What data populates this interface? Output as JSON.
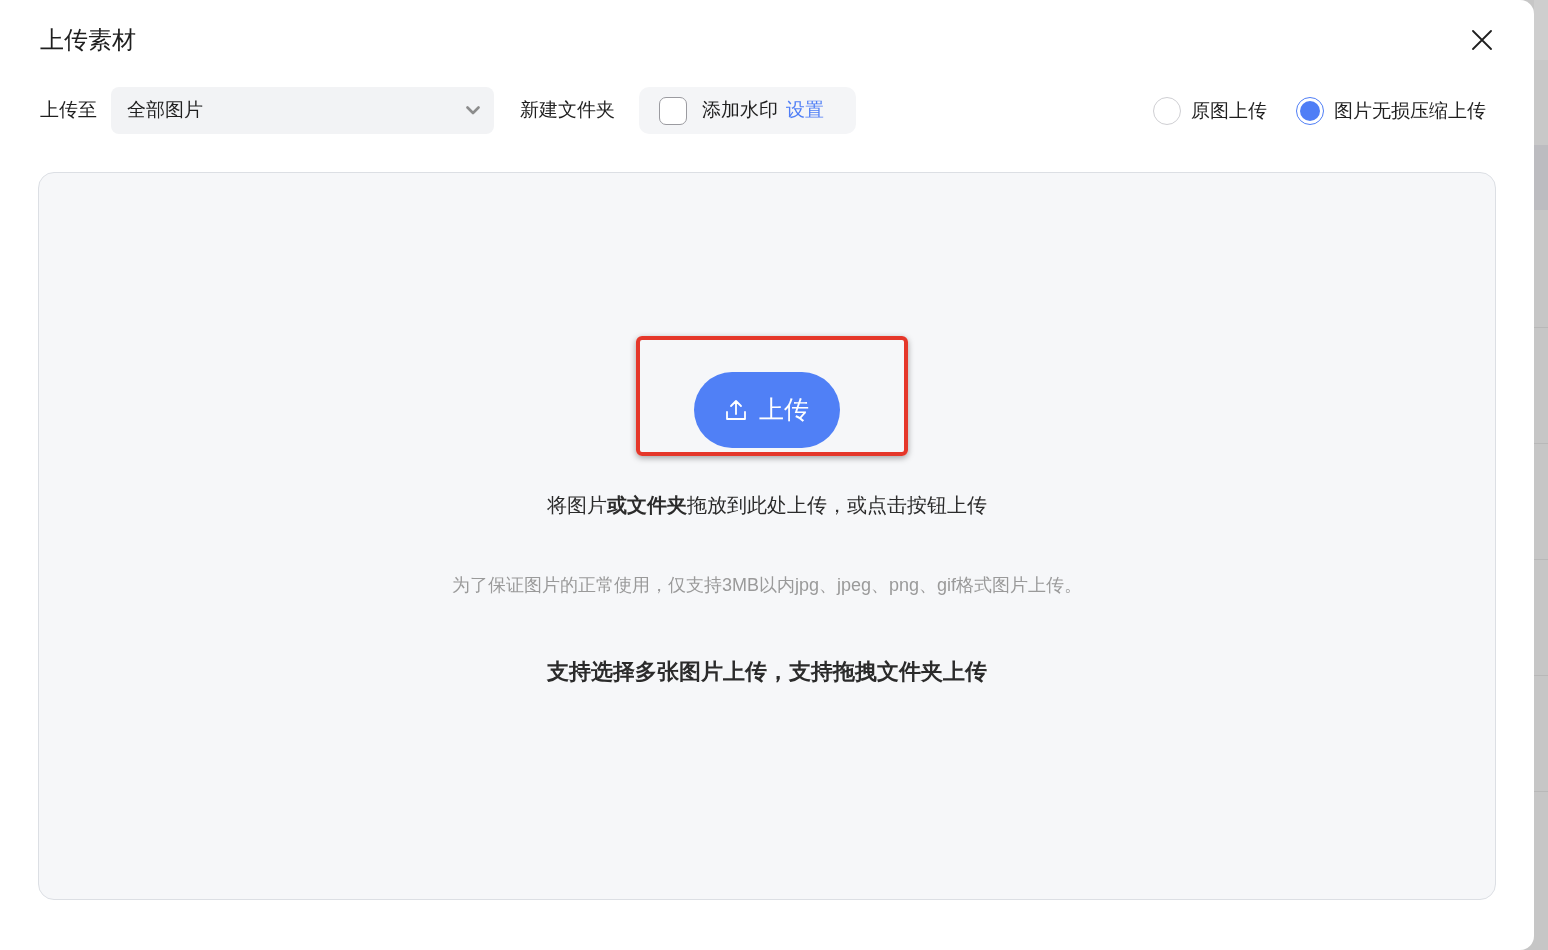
{
  "dialog": {
    "title": "上传素材"
  },
  "toolbar": {
    "upload_to": {
      "label": "上传至",
      "value": "全部图片"
    },
    "new_folder": "新建文件夹",
    "watermark": {
      "label": "添加水印",
      "checked": false,
      "settings_link": "设置"
    },
    "upload_modes": [
      {
        "label": "原图上传",
        "selected": false
      },
      {
        "label": "图片无损压缩上传",
        "selected": true
      }
    ]
  },
  "drop_zone": {
    "button": "上传",
    "highlighted": true,
    "instruction": "将图片**或文件夹**拖放到此处上传，或点击按钮上传",
    "note": "为了保证图片的正常使用，仅支持3MB以内jpg、jpeg、png、gif格式图片上传。",
    "tip": "支持选择多张图片上传，支持拖拽文件夹上传"
  }
}
